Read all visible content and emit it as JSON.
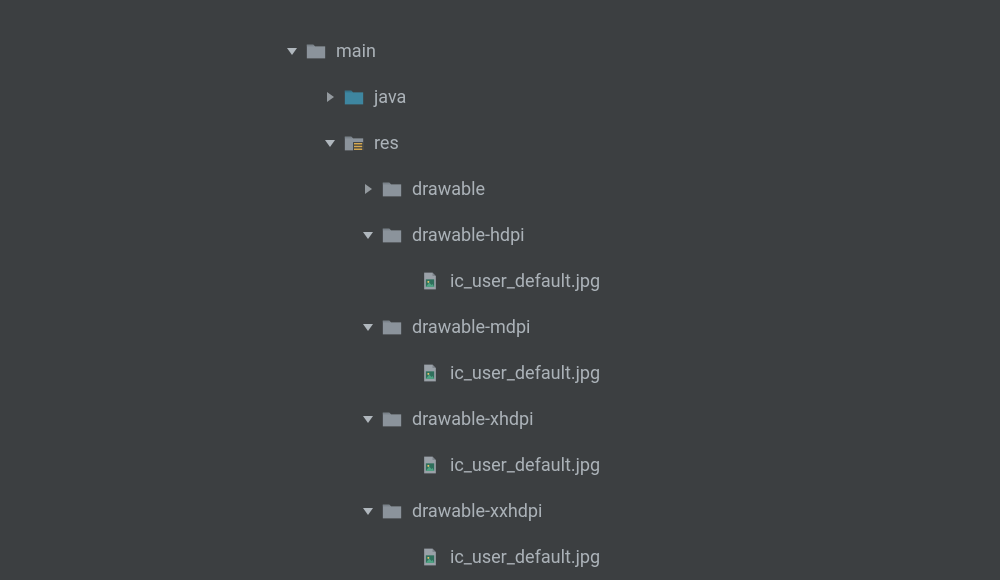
{
  "tree": {
    "main": {
      "label": "main",
      "java": {
        "label": "java"
      },
      "res": {
        "label": "res",
        "drawable": {
          "label": "drawable"
        },
        "drawable_hdpi": {
          "label": "drawable-hdpi",
          "file": {
            "label": "ic_user_default.jpg"
          }
        },
        "drawable_mdpi": {
          "label": "drawable-mdpi",
          "file": {
            "label": "ic_user_default.jpg"
          }
        },
        "drawable_xhdpi": {
          "label": "drawable-xhdpi",
          "file": {
            "label": "ic_user_default.jpg"
          }
        },
        "drawable_xxhdpi": {
          "label": "drawable-xxhdpi",
          "file": {
            "label": "ic_user_default.jpg"
          }
        }
      }
    }
  },
  "colors": {
    "background": "#3c3f41",
    "text": "#abb2b8",
    "arrow_expanded": "#b0b7bd",
    "arrow_collapsed": "#949a9f",
    "folder_gray": "#8a929a",
    "folder_blue": "#3e86a0",
    "res_badge": "#d8a94e"
  }
}
